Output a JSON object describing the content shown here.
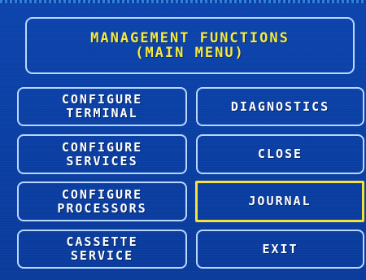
{
  "title": {
    "line1": "MANAGEMENT FUNCTIONS",
    "line2": "(MAIN MENU)"
  },
  "buttons": {
    "configure_terminal": {
      "line1": "CONFIGURE",
      "line2": "TERMINAL"
    },
    "configure_services": {
      "line1": "CONFIGURE",
      "line2": "SERVICES"
    },
    "configure_processors": {
      "line1": "CONFIGURE",
      "line2": "PROCESSORS"
    },
    "cassette_service": {
      "line1": "CASSETTE",
      "line2": "SERVICE"
    },
    "diagnostics": "DIAGNOSTICS",
    "close": "CLOSE",
    "journal": "JOURNAL",
    "exit": "EXIT"
  },
  "colors": {
    "background": "#0a3fa3",
    "title_text": "#f4ea3c",
    "button_text": "#ffffff",
    "border": "#b9d7ff",
    "selected_border": "#f4e23a"
  },
  "selected_button": "journal"
}
